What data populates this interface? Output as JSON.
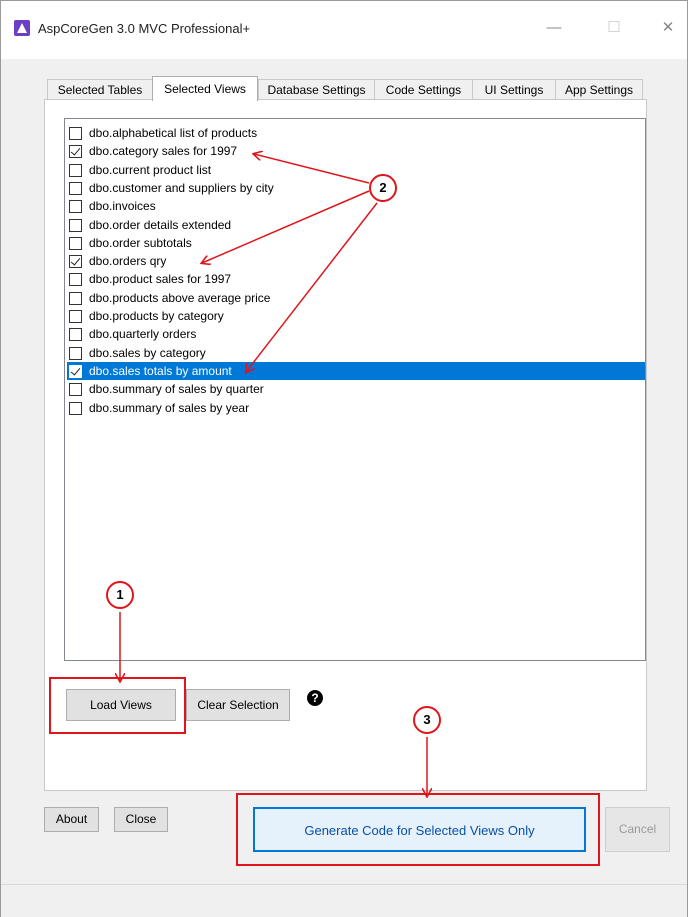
{
  "window": {
    "title": "AspCoreGen 3.0 MVC Professional+",
    "controls": {
      "minimize": "—",
      "maximize": "☐",
      "close": "✕"
    }
  },
  "tabs": [
    {
      "label": "Selected Tables",
      "active": false
    },
    {
      "label": "Selected Views",
      "active": true
    },
    {
      "label": "Database Settings",
      "active": false
    },
    {
      "label": "Code Settings",
      "active": false
    },
    {
      "label": "UI Settings",
      "active": false
    },
    {
      "label": "App Settings",
      "active": false
    }
  ],
  "views_list": {
    "items": [
      {
        "label": "dbo.alphabetical list of products",
        "checked": false,
        "selected": false
      },
      {
        "label": "dbo.category sales for 1997",
        "checked": true,
        "selected": false
      },
      {
        "label": "dbo.current product list",
        "checked": false,
        "selected": false
      },
      {
        "label": "dbo.customer and suppliers by city",
        "checked": false,
        "selected": false
      },
      {
        "label": "dbo.invoices",
        "checked": false,
        "selected": false
      },
      {
        "label": "dbo.order details extended",
        "checked": false,
        "selected": false
      },
      {
        "label": "dbo.order subtotals",
        "checked": false,
        "selected": false
      },
      {
        "label": "dbo.orders qry",
        "checked": true,
        "selected": false
      },
      {
        "label": "dbo.product sales for 1997",
        "checked": false,
        "selected": false
      },
      {
        "label": "dbo.products above average price",
        "checked": false,
        "selected": false
      },
      {
        "label": "dbo.products by category",
        "checked": false,
        "selected": false
      },
      {
        "label": "dbo.quarterly orders",
        "checked": false,
        "selected": false
      },
      {
        "label": "dbo.sales by category",
        "checked": false,
        "selected": false
      },
      {
        "label": "dbo.sales totals by amount",
        "checked": true,
        "selected": true
      },
      {
        "label": "dbo.summary of sales by quarter",
        "checked": false,
        "selected": false
      },
      {
        "label": "dbo.summary of sales by year",
        "checked": false,
        "selected": false
      }
    ]
  },
  "buttons": {
    "load_views": "Load Views",
    "clear_selection": "Clear Selection",
    "help": "?",
    "about": "About",
    "close": "Close",
    "generate": "Generate Code for Selected Views Only",
    "cancel": "Cancel"
  },
  "annotations": {
    "step_1": "1",
    "step_2": "2",
    "step_3": "3",
    "color": "#e0151b"
  },
  "colors": {
    "selection": "#0078d7",
    "primary_button_border": "#0078d7"
  }
}
